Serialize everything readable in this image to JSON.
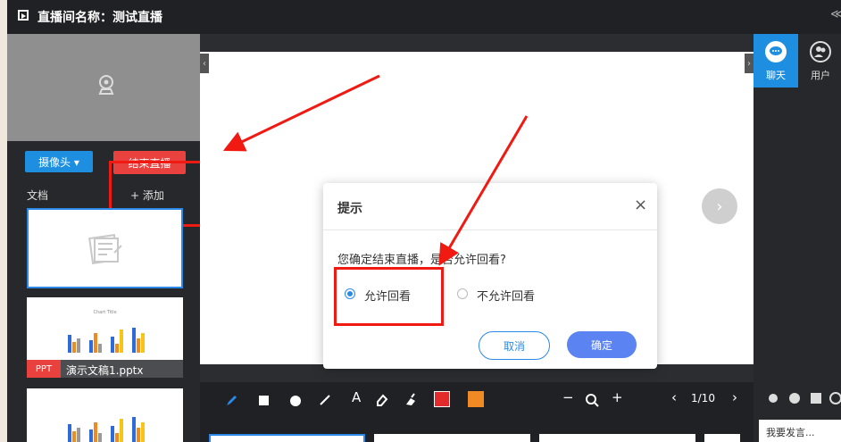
{
  "header": {
    "title": "直播间名称：测试直播",
    "more": "≪"
  },
  "left": {
    "camera_button": "摄像头 ▾",
    "end_button": "结束直播",
    "doc_label": "文档",
    "add_label": "+ 添加",
    "thumb2_tag": "PPT",
    "thumb2_caption": "演示文稿1.pptx",
    "thumb_chart_title": "Chart Title"
  },
  "toolbar": {
    "text_tool": "A",
    "zoom_out": "−",
    "zoom_in": "+",
    "prev": "‹",
    "page": "1/10",
    "next": "›",
    "color_red": "#e32b2b",
    "color_orange": "#f08a24"
  },
  "right": {
    "chat_tab": "聊天",
    "users_tab": "用户",
    "chat_placeholder": "我要发言..."
  },
  "dialog": {
    "title": "提示",
    "close": "×",
    "message": "您确定结束直播，是否允许回看?",
    "option_allow": "允许回看",
    "option_deny": "不允许回看",
    "cancel": "取消",
    "confirm": "确定"
  },
  "colors": {
    "accent": "#1e8fe0",
    "danger": "#e8413e",
    "annotation": "#f01a12",
    "confirm": "#5b84f2"
  }
}
